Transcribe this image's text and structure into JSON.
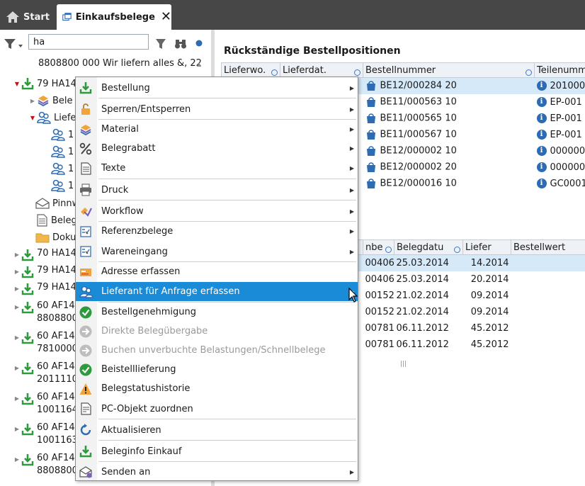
{
  "tabs": [
    {
      "label": "Start"
    },
    {
      "label": "Einkaufsbelege"
    }
  ],
  "toolbar": {
    "search_value": "ha"
  },
  "tree": {
    "top_partial": "8808800 000 Wir liefern alles &, 22",
    "selected_node": "79 HA14",
    "children": [
      "Bele",
      "Liefer"
    ],
    "sub_children": [
      "1",
      "1",
      "1",
      "1"
    ],
    "other_children": [
      "Pinnw",
      "Beleg",
      "Doku"
    ],
    "nodes": [
      {
        "line1": "70 HA14",
        "line2": ""
      },
      {
        "line1": "79 HA14",
        "line2": ""
      },
      {
        "line1": "79 HA14",
        "line2": ""
      },
      {
        "line1": "60 AF14",
        "line2": "8808800"
      },
      {
        "line1": "60 AF14",
        "line2": "7810000"
      },
      {
        "line1": "60 AF14",
        "line2": "2011110"
      },
      {
        "line1": "60 AF14",
        "line2": "1001164"
      },
      {
        "line1": "60 AF14",
        "line2": "1001163"
      },
      {
        "line1": "60 AF14",
        "line2": "8808800"
      }
    ]
  },
  "right": {
    "title": "Rückständige Bestellpositionen",
    "grid1": {
      "columns": [
        "Lieferwo.",
        "Lieferdat.",
        "Bestellnummer",
        "Teilenummer"
      ],
      "rows": [
        {
          "bestellnummer": "BE12/000284 20",
          "teil": "201000"
        },
        {
          "bestellnummer": "BE11/000563 10",
          "teil": "EP-001"
        },
        {
          "bestellnummer": "BE11/000565 10",
          "teil": "EP-001"
        },
        {
          "bestellnummer": "BE11/000567 10",
          "teil": "EP-001"
        },
        {
          "bestellnummer": "BE12/000002 10",
          "teil": "000000"
        },
        {
          "bestellnummer": "BE12/000002 20",
          "teil": "000000"
        },
        {
          "bestellnummer": "BE12/000016 10",
          "teil": "GC0001"
        }
      ]
    },
    "grid2": {
      "columns": [
        "nbe",
        "Belegdatu",
        "Liefer",
        "Bestellwert"
      ],
      "rows": [
        {
          "nr": "00406",
          "datum": "25.03.2014",
          "liefer": "14.2014"
        },
        {
          "nr": "00406",
          "datum": "25.03.2014",
          "liefer": "20.2014"
        },
        {
          "nr": "00152",
          "datum": "21.02.2014",
          "liefer": "09.2014"
        },
        {
          "nr": "00152",
          "datum": "21.02.2014",
          "liefer": "09.2014"
        },
        {
          "nr": "00781",
          "datum": "06.11.2012",
          "liefer": "45.2012"
        },
        {
          "nr": "00781",
          "datum": "06.11.2012",
          "liefer": "45.2012"
        }
      ]
    }
  },
  "context_menu": {
    "items": [
      {
        "label": "Bestellung",
        "icon": "download-arrow-icon",
        "submenu": true
      },
      {
        "label": "Sperren/Entsperren",
        "icon": "lock-icon",
        "submenu": true
      },
      {
        "label": "Material",
        "icon": "material-stack-icon",
        "submenu": true
      },
      {
        "label": "Belegrabatt",
        "icon": "percent-icon",
        "submenu": true
      },
      {
        "label": "Texte",
        "icon": "document-text-icon",
        "submenu": true
      },
      {
        "label": "Druck",
        "icon": "printer-icon",
        "submenu": true
      },
      {
        "label": "Workflow",
        "icon": "workflow-icon",
        "submenu": true
      },
      {
        "label": "Referenzbelege",
        "icon": "reference-doc-icon",
        "submenu": true
      },
      {
        "label": "Wareneingang",
        "icon": "goods-receipt-icon",
        "submenu": true
      },
      {
        "label": "Adresse erfassen",
        "icon": "address-card-icon",
        "submenu": false
      },
      {
        "label": "Lieferant für Anfrage erfassen",
        "icon": "supplier-users-icon",
        "submenu": true
      },
      {
        "label": "Bestellgenehmigung",
        "icon": "check-circle-icon",
        "submenu": false
      },
      {
        "label": "Direkte Belegübergabe",
        "icon": "arrow-right-circle-icon",
        "submenu": false
      },
      {
        "label": "Buchen unverbuchte Belastungen/Schnellbelege",
        "icon": "arrow-right-circle-icon",
        "submenu": false
      },
      {
        "label": "Beistelllieferung",
        "icon": "check-circle-icon",
        "submenu": false
      },
      {
        "label": "Belegstatushistorie",
        "icon": "warning-triangle-icon",
        "submenu": false
      },
      {
        "label": "PC-Objekt zuordnen",
        "icon": "pc-object-icon",
        "submenu": false
      },
      {
        "label": "Aktualisieren",
        "icon": "refresh-icon",
        "submenu": false
      },
      {
        "label": "Beleginfo Einkauf",
        "icon": "download-arrow-icon",
        "submenu": false
      },
      {
        "label": "Senden an",
        "icon": "send-mail-icon",
        "submenu": true
      }
    ]
  },
  "colors": {
    "topbar": "#474747",
    "menu_highlight": "#1a8bd6",
    "selection_row": "#d6e9f8",
    "download_green": "#2e9a3e"
  }
}
